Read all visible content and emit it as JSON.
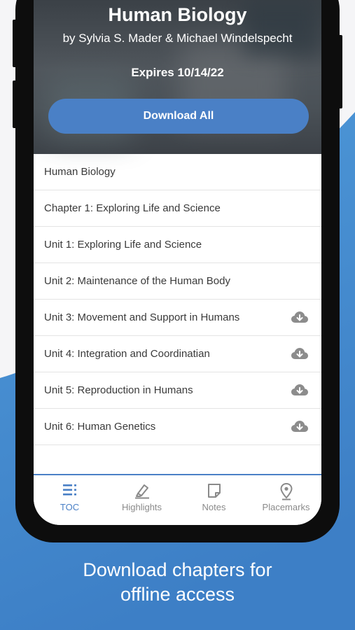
{
  "book": {
    "title": "Human Biology",
    "authors": "by Sylvia S. Mader & Michael Windelspecht",
    "expires": "Expires 10/14/22",
    "download_all_label": "Download All"
  },
  "toc": {
    "items": [
      {
        "label": "Human Biology",
        "downloadable": false
      },
      {
        "label": "Chapter 1: Exploring Life and Science",
        "downloadable": false
      },
      {
        "label": "Unit 1: Exploring Life and Science",
        "downloadable": false
      },
      {
        "label": "Unit 2: Maintenance of the Human Body",
        "downloadable": false
      },
      {
        "label": "Unit 3: Movement and Support in Humans",
        "downloadable": true,
        "icon": "cloud-download-icon"
      },
      {
        "label": "Unit 4: Integration and Coordinatian",
        "downloadable": true,
        "icon": "cloud-download-icon"
      },
      {
        "label": "Unit 5: Reproduction in Humans",
        "downloadable": true,
        "icon": "cloud-download-icon"
      },
      {
        "label": "Unit 6: Human Genetics",
        "downloadable": true,
        "icon": "cloud-download-icon"
      }
    ]
  },
  "tabs": [
    {
      "label": "TOC",
      "icon": "list-icon",
      "active": true
    },
    {
      "label": "Highlights",
      "icon": "highlighter-icon",
      "active": false
    },
    {
      "label": "Notes",
      "icon": "note-icon",
      "active": false
    },
    {
      "label": "Placemarks",
      "icon": "map-pin-icon",
      "active": false
    }
  ],
  "caption": {
    "line1": "Download chapters for",
    "line2": "offline access"
  },
  "colors": {
    "accent": "#4a80c6",
    "background_blue": "#4a8fd4",
    "phone_frame": "#0d0d0d"
  }
}
